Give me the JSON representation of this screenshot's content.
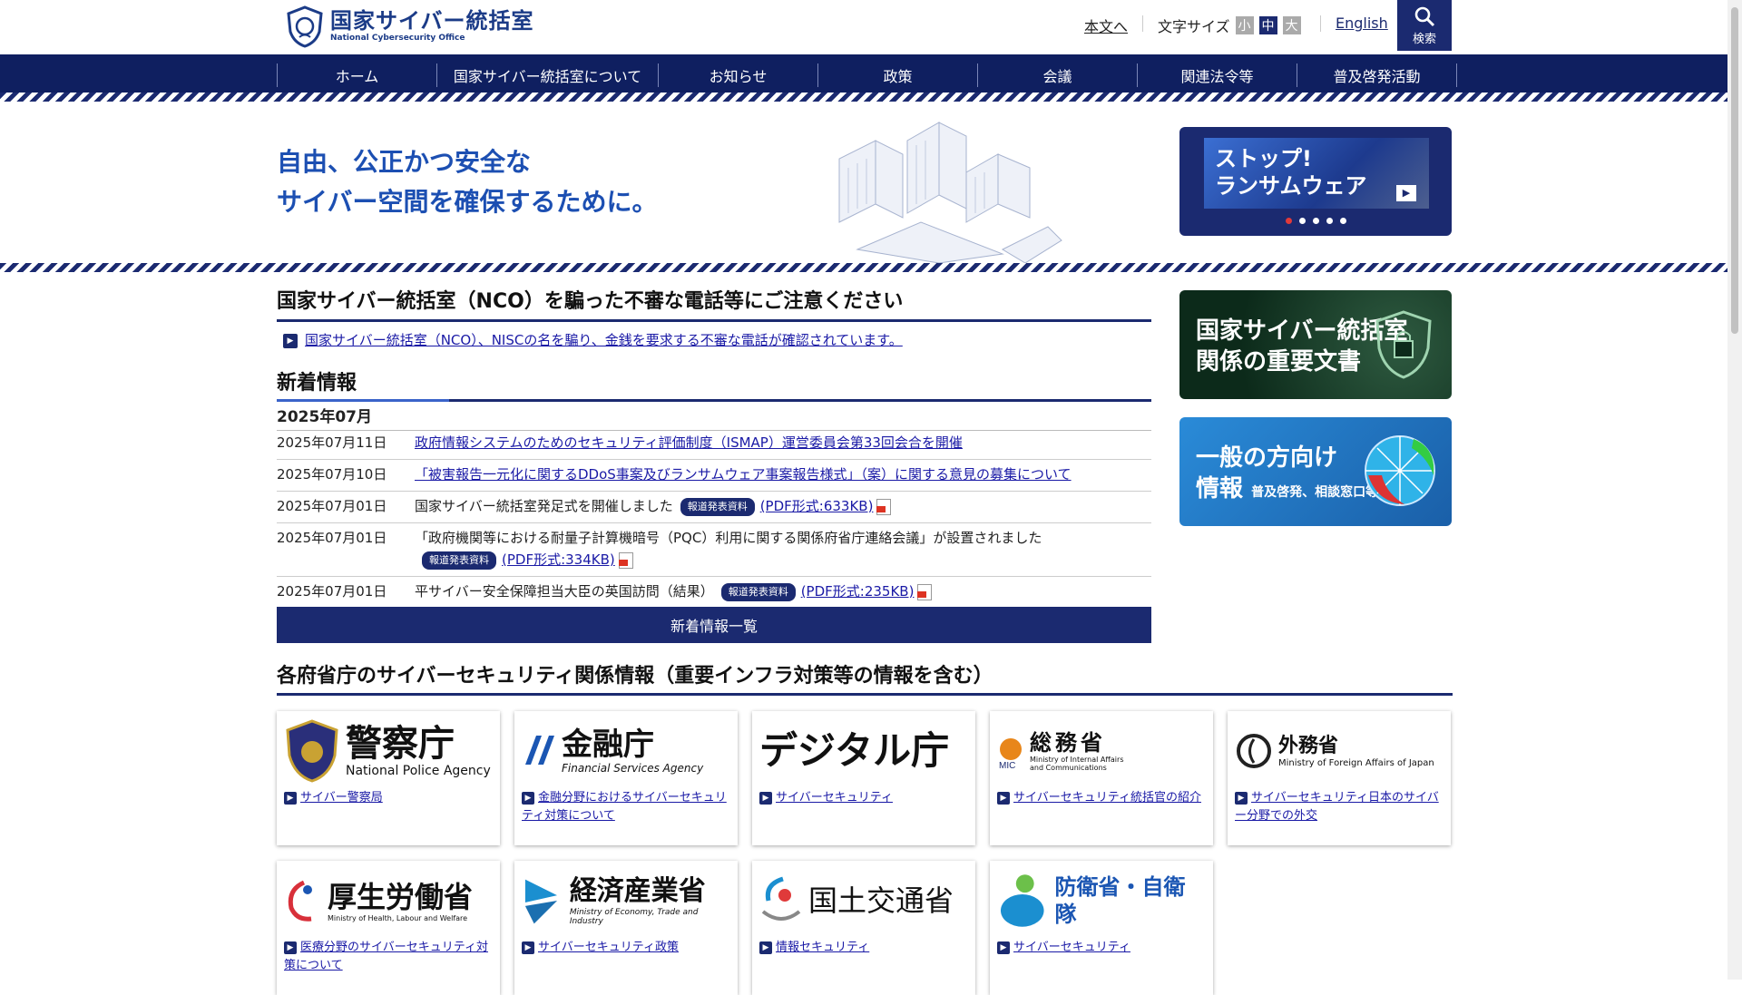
{
  "header": {
    "logo_ja": "国家サイバー統括室",
    "logo_en": "National Cybersecurity Office",
    "skip_link": "本文へ",
    "font_size_label": "文字サイズ",
    "font_sizes": [
      "小",
      "中",
      "大"
    ],
    "english": "English",
    "search": "検索"
  },
  "nav": [
    "ホーム",
    "国家サイバー統括室について",
    "お知らせ",
    "政策",
    "会議",
    "関連法令等",
    "普及啓発活動"
  ],
  "hero": {
    "line1": "自由、公正かつ安全な",
    "line2": "サイバー空間を確保するために。",
    "slide_line1": "ストップ!",
    "slide_line2": "ランサムウェア",
    "play_icon": "▶"
  },
  "alert": {
    "title": "国家サイバー統括室（NCO）を騙った不審な電話等にご注意ください",
    "link": "国家サイバー統括室（NCO）、NISCの名を騙り、金銭を要求する不審な電話が確認されています。"
  },
  "news": {
    "title": "新着情報",
    "month": "2025年07月",
    "items": [
      {
        "date": "2025年07月11日",
        "text": "政府情報システムのためのセキュリティ評価制度（ISMAP）運営委員会第33回会合を開催"
      },
      {
        "date": "2025年07月10日",
        "text": "「被害報告一元化に関するDDoS事案及びランサムウェア事案報告様式」（案）に関する意見の募集について"
      },
      {
        "date": "2025年07月01日",
        "text": "国家サイバー統括室発足式を開催しました",
        "badge": "報道発表資料",
        "pdf": "(PDF形式:633KB)"
      },
      {
        "date": "2025年07月01日",
        "text": "「政府機関等における耐量子計算機暗号（PQC）利用に関する関係府省庁連絡会議」が設置されました",
        "badge": "報道発表資料",
        "pdf": "(PDF形式:334KB)"
      },
      {
        "date": "2025年07月01日",
        "text": "平サイバー安全保障担当大臣の英国訪問（結果）",
        "badge": "報道発表資料",
        "pdf": "(PDF形式:235KB)"
      }
    ],
    "more": "新着情報一覧"
  },
  "side": {
    "banner1_line1": "国家サイバー統括室",
    "banner1_line2": "関係の重要文書",
    "banner2_line1": "一般の方向け",
    "banner2_line2": "情報",
    "banner2_sub": "普及啓発、相談窓口等"
  },
  "ministries": {
    "title": "各府省庁のサイバーセキュリティ関係情報（重要インフラ対策等の情報を含む）",
    "cards": [
      {
        "logo_ja": "警察庁",
        "logo_en": "National Police Agency",
        "link": "サイバー警察局"
      },
      {
        "logo_ja": "金融庁",
        "logo_en": "Financial Services Agency",
        "link": "金融分野におけるサイバーセキュリティ対策について"
      },
      {
        "logo_ja": "デジタル庁",
        "logo_en": "",
        "link": "サイバーセキュリティ"
      },
      {
        "logo_ja": "総務省",
        "logo_en": "Ministry of Internal Affairs and Communications",
        "link": "サイバーセキュリティ統括官の紹介"
      },
      {
        "logo_ja": "外務省",
        "logo_en": "Ministry of Foreign Affairs of Japan",
        "link": "サイバーセキュリティ日本のサイバー分野での外交"
      },
      {
        "logo_ja": "厚生労働省",
        "logo_en": "Ministry of Health, Labour and Welfare",
        "link": "医療分野のサイバーセキュリティ対策について"
      },
      {
        "logo_ja": "経済産業省",
        "logo_en": "Ministry of Economy, Trade and Industry",
        "link": "サイバーセキュリティ政策"
      },
      {
        "logo_ja": "国土交通省",
        "logo_en": "",
        "link": "情報セキュリティ"
      },
      {
        "logo_ja": "防衛省・自衛隊",
        "logo_en": "",
        "link": "サイバーセキュリティ"
      }
    ]
  },
  "colors": {
    "primary": "#1b2a70",
    "accent": "#1c4fb2",
    "link": "#1a1aa6"
  }
}
